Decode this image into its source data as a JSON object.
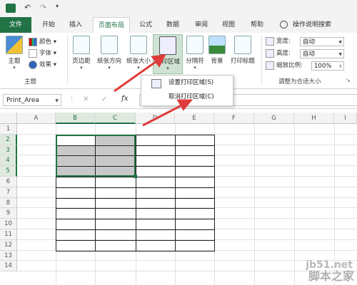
{
  "quick_access": {
    "undo": "↶",
    "redo": "↷",
    "customize": "▾"
  },
  "tabs": {
    "file": "文件",
    "items": [
      "开始",
      "插入",
      "页面布局",
      "公式",
      "数据",
      "审阅",
      "视图",
      "帮助"
    ],
    "active": "页面布局",
    "tell_me": "操作说明搜索"
  },
  "ribbon": {
    "themes": {
      "theme": "主题",
      "colors": "颜色",
      "fonts": "字体",
      "effects": "效果",
      "group": "主题"
    },
    "page_setup": {
      "margins": "页边距",
      "orientation": "纸张方向",
      "size": "纸张大小",
      "print_area": "打印区域",
      "breaks": "分隔符",
      "background": "背景",
      "print_titles": "打印标题"
    },
    "scale": {
      "width_label": "宽度:",
      "width_value": "自动",
      "height_label": "高度:",
      "height_value": "自动",
      "scale_label": "缩放比例:",
      "scale_value": "100%",
      "group": "调整为合适大小"
    }
  },
  "dropdown": {
    "set_print_area": "设置打印区域(S)",
    "clear_print_area": "取消打印区域(C)"
  },
  "formula_bar": {
    "name_box": "Print_Area",
    "cancel": "✕",
    "enter": "✓",
    "fx": "fx",
    "formula": ""
  },
  "sheet": {
    "columns": [
      "A",
      "B",
      "C",
      "D",
      "E",
      "F",
      "G",
      "H",
      "I"
    ],
    "rows": [
      "1",
      "2",
      "3",
      "4",
      "5",
      "6",
      "7",
      "8",
      "9",
      "10",
      "11",
      "12",
      "13",
      "14"
    ]
  },
  "watermark": {
    "line1": "jb51.net",
    "line2": "脚本之家"
  },
  "colors": {
    "excel_green": "#217346",
    "annotation_red": "#e03c3c",
    "cell_grey": "#c8c8c8"
  }
}
